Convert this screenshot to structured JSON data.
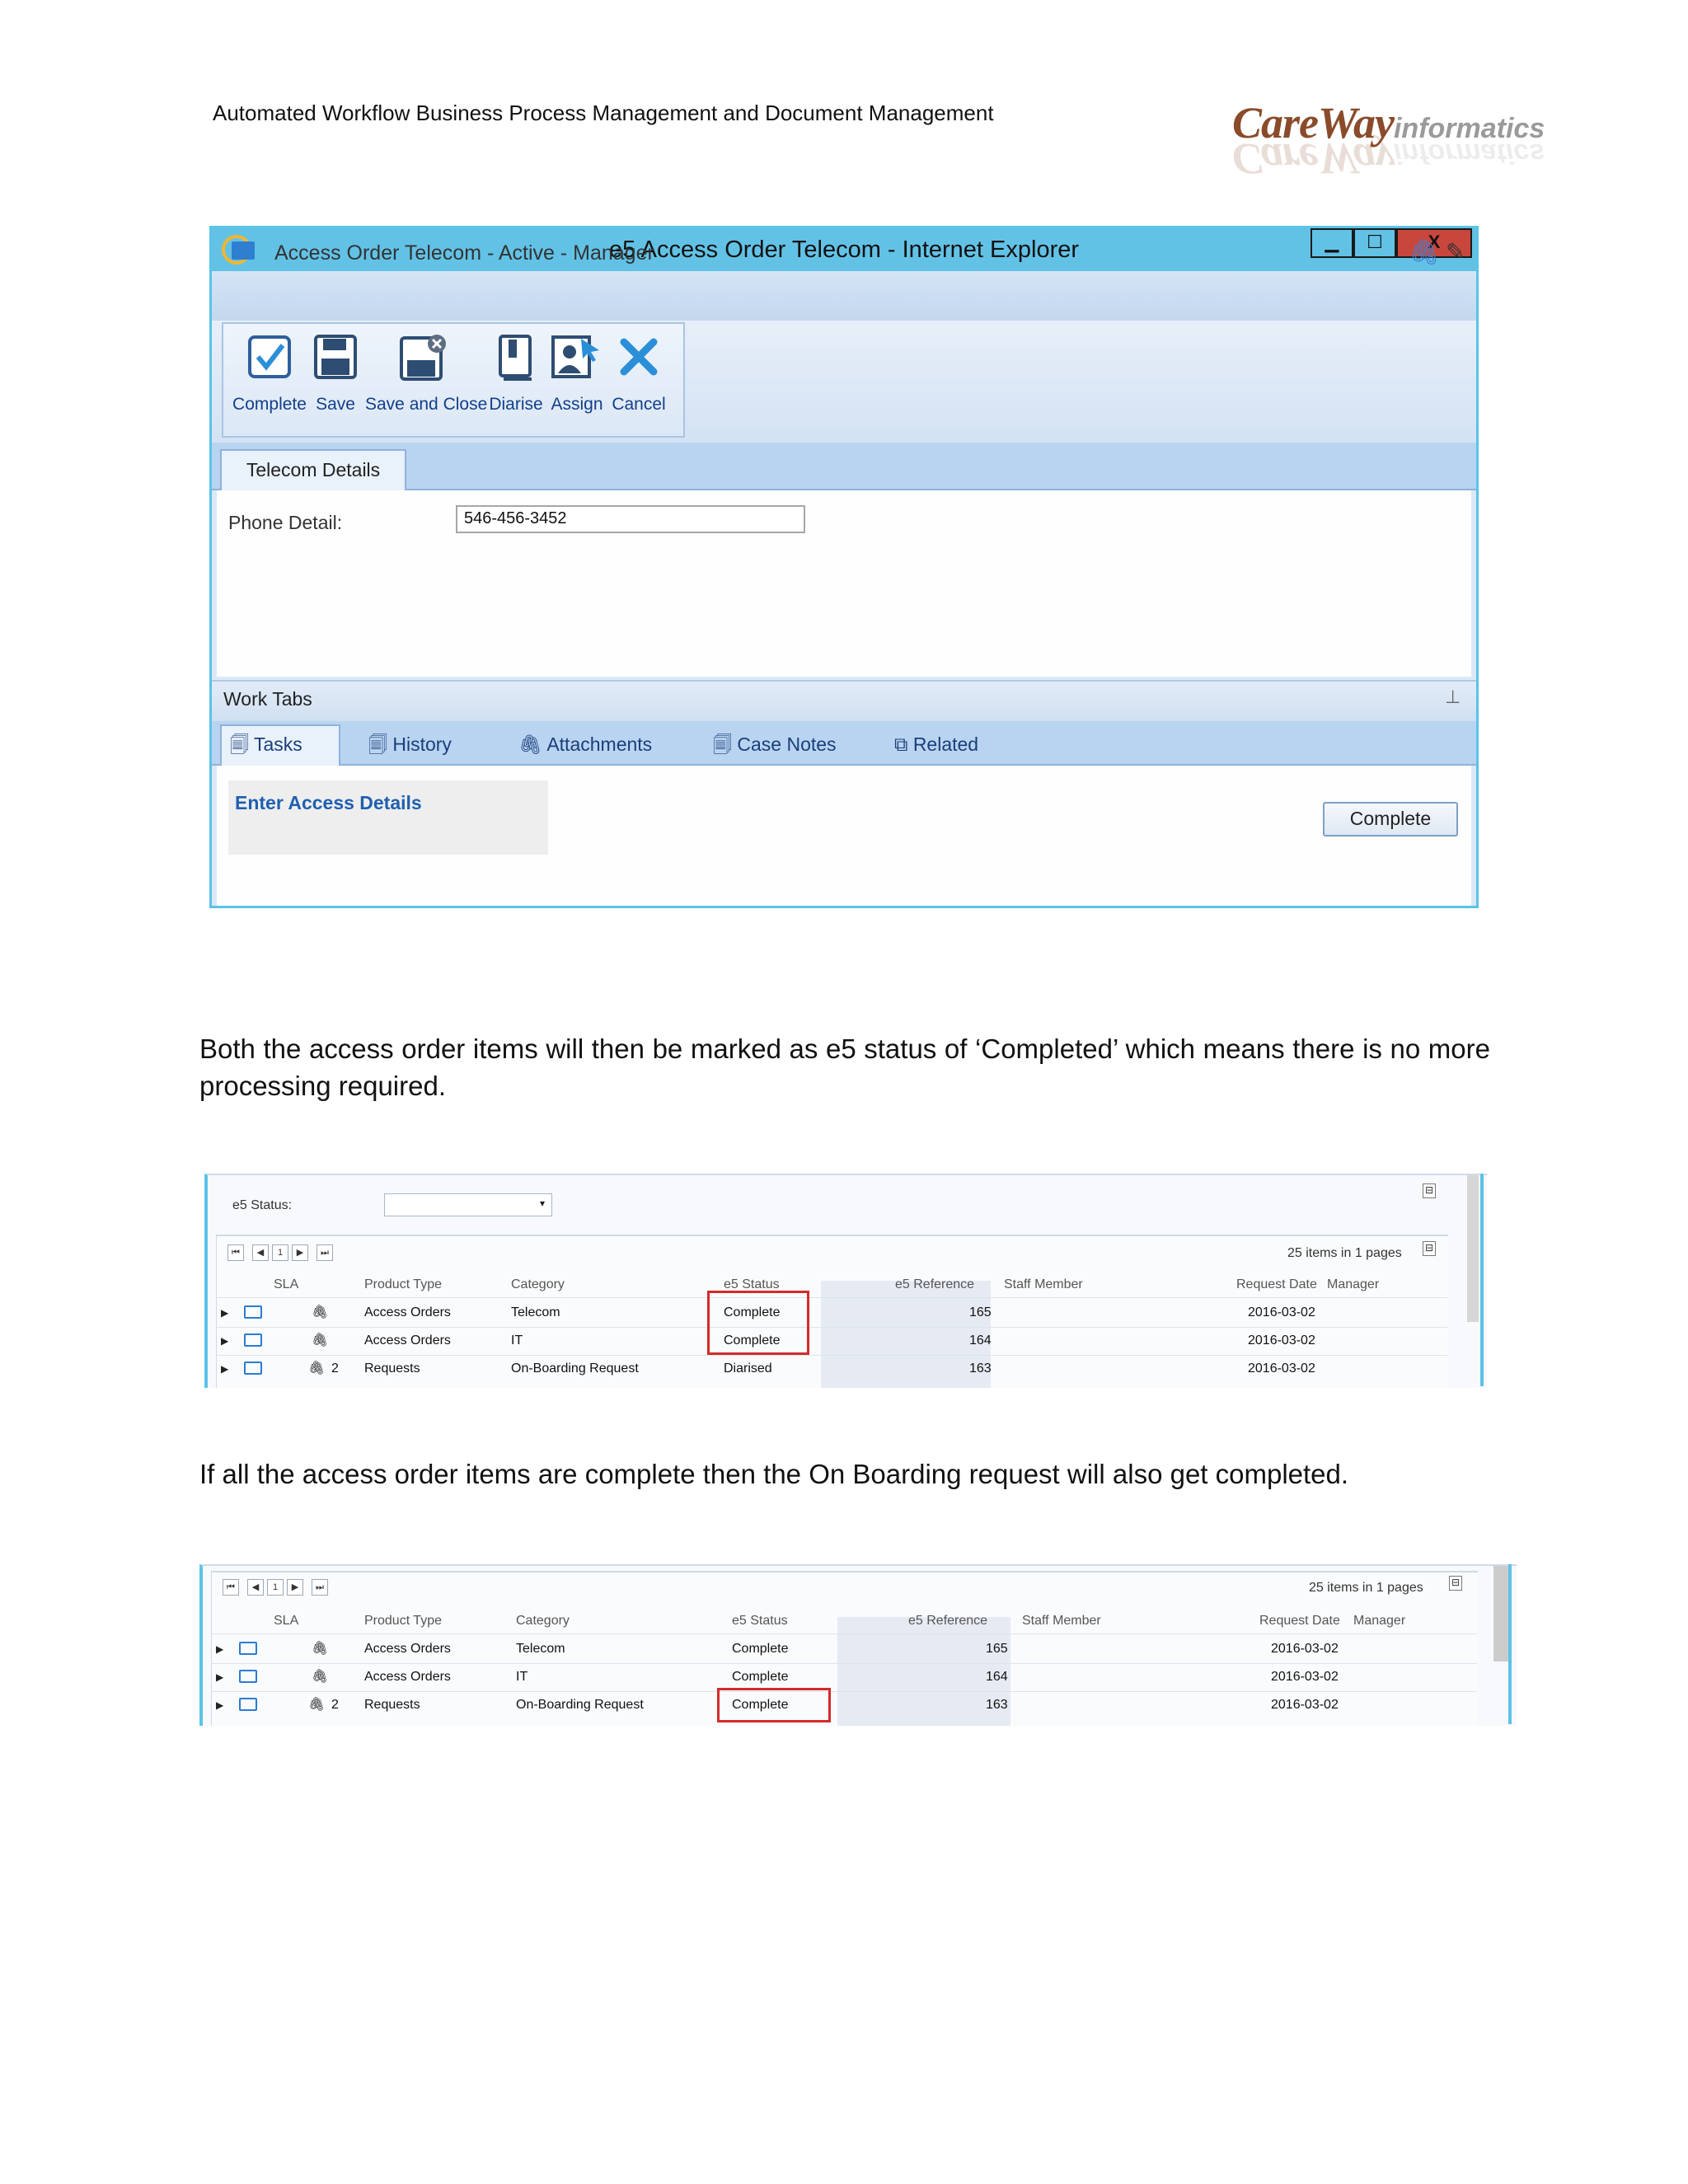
{
  "header": {
    "title": "Automated Workflow Business Process Management and Document Management",
    "logo_main": "CareWay",
    "logo_sub": "informatics"
  },
  "ie_window": {
    "title": "e5 Access Order Telecom - Internet Explorer",
    "min": "▁",
    "max": "☐",
    "close": "X",
    "form_title": "Access Order Telecom - Active - Manager",
    "ribbon": {
      "complete": "Complete",
      "save": "Save",
      "save_close": "Save and Close",
      "diarise": "Diarise",
      "assign": "Assign",
      "cancel": "Cancel"
    },
    "details_tab": "Telecom Details",
    "phone_label": "Phone Detail:",
    "phone_value": "546-456-3452",
    "work_tabs_title": "Work Tabs",
    "work_tabs": [
      "Tasks",
      "History",
      "Attachments",
      "Case Notes",
      "Related"
    ],
    "task_link": "Enter Access Details",
    "complete_button": "Complete"
  },
  "paragraphs": {
    "p1": "Both the access order items will then be marked as e5 status of ‘Completed’ which means there is no more processing required.",
    "p2": "If all the access order items are complete then the On Boarding request will also get completed."
  },
  "grid1": {
    "filter_label": "e5 Status:",
    "page_number": "1",
    "items_summary": "25 items in 1 pages",
    "headers": [
      "SLA",
      "Product Type",
      "Category",
      "e5 Status",
      "e5 Reference",
      "Staff Member",
      "Request Date",
      "Manager"
    ],
    "rows": [
      {
        "attach": "",
        "product": "Access Orders",
        "category": "Telecom",
        "status": "Complete",
        "ref": "165",
        "date": "2016-03-02"
      },
      {
        "attach": "",
        "product": "Access Orders",
        "category": "IT",
        "status": "Complete",
        "ref": "164",
        "date": "2016-03-02"
      },
      {
        "attach": "2",
        "product": "Requests",
        "category": "On-Boarding Request",
        "status": "Diarised",
        "ref": "163",
        "date": "2016-03-02"
      }
    ]
  },
  "grid2": {
    "page_number": "1",
    "items_summary": "25 items in 1 pages",
    "headers": [
      "SLA",
      "Product Type",
      "Category",
      "e5 Status",
      "e5 Reference",
      "Staff Member",
      "Request Date",
      "Manager"
    ],
    "rows": [
      {
        "attach": "",
        "product": "Access Orders",
        "category": "Telecom",
        "status": "Complete",
        "ref": "165",
        "date": "2016-03-02"
      },
      {
        "attach": "",
        "product": "Access Orders",
        "category": "IT",
        "status": "Complete",
        "ref": "164",
        "date": "2016-03-02"
      },
      {
        "attach": "2",
        "product": "Requests",
        "category": "On-Boarding Request",
        "status": "Complete",
        "ref": "163",
        "date": "2016-03-02"
      }
    ]
  },
  "colors": {
    "window_border": "#5cc3e8",
    "title_bar": "#62c2e6",
    "highlight_box": "#d32b2b",
    "link": "#1f5fb0"
  },
  "icons": [
    "ie-logo-icon",
    "form-icon",
    "paperclip-icon",
    "pin-icon",
    "check-icon",
    "save-icon",
    "save-close-icon",
    "diarise-icon",
    "assign-icon",
    "cancel-icon",
    "tasks-icon",
    "history-icon",
    "attachments-icon",
    "case-notes-icon",
    "related-icon",
    "folder-icon",
    "expand-arrow-icon",
    "collapse-icon"
  ]
}
